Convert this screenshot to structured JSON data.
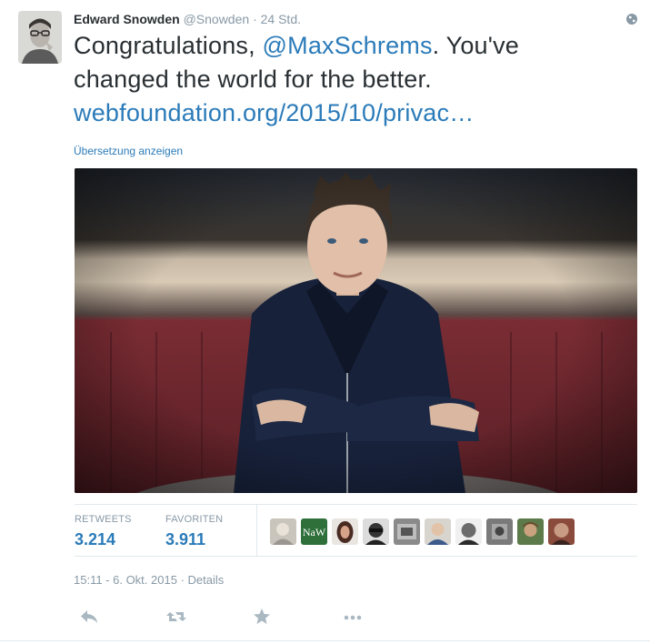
{
  "tweet": {
    "author": {
      "name": "Edward Snowden",
      "handle": "@Snowden",
      "separator": "·",
      "time_ago": "24 Std.",
      "avatar_icon": "avatar-photo"
    },
    "text": {
      "lead": "Congratulations, ",
      "mention": "@MaxSchrems",
      "after": ". You've changed the world for the better.",
      "link": "webfoundation.org/2015/10/privac…"
    },
    "translate_label": "Übersetzung anzeigen",
    "stats": {
      "retweets_label": "RETWEETS",
      "retweets_value": "3.214",
      "favorites_label": "FAVORITEN",
      "favorites_value": "3.911"
    },
    "faces": [
      "face-1",
      "face-2-naw",
      "face-3",
      "face-4",
      "face-5",
      "face-6",
      "face-7",
      "face-8",
      "face-9",
      "face-10"
    ],
    "naw_label": "NaW",
    "timestamp": "15:11 - 6. Okt. 2015",
    "details_separator": " · ",
    "details_label": "Details",
    "colors": {
      "link": "#2b7bb9",
      "muted": "#8899a6",
      "text": "#292f33",
      "border": "#e1e8ed"
    },
    "actions": [
      "reply-icon",
      "retweet-icon",
      "favorite-icon",
      "more-icon"
    ]
  }
}
